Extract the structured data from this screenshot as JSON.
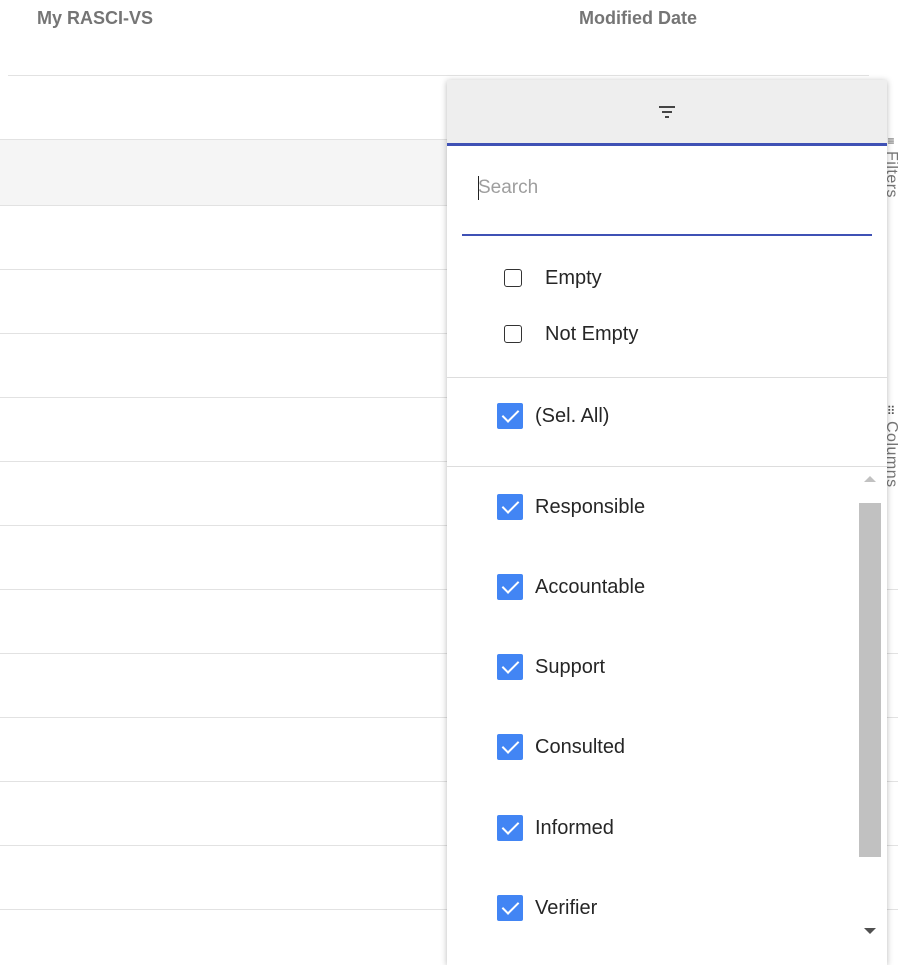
{
  "grid": {
    "column_headers": [
      "My RASCI-VS",
      "Modified Date"
    ]
  },
  "side_tabs": {
    "filters": "Filters",
    "columns": "Columns"
  },
  "filter_popup": {
    "search_placeholder": "Search",
    "empty_option": "Empty",
    "not_empty_option": "Not Empty",
    "select_all": "(Sel. All)",
    "values": [
      "Responsible",
      "Accountable",
      "Support",
      "Consulted",
      "Informed",
      "Verifier"
    ]
  },
  "colors": {
    "accent": "#3f51b5",
    "checkbox": "#4285f4"
  }
}
